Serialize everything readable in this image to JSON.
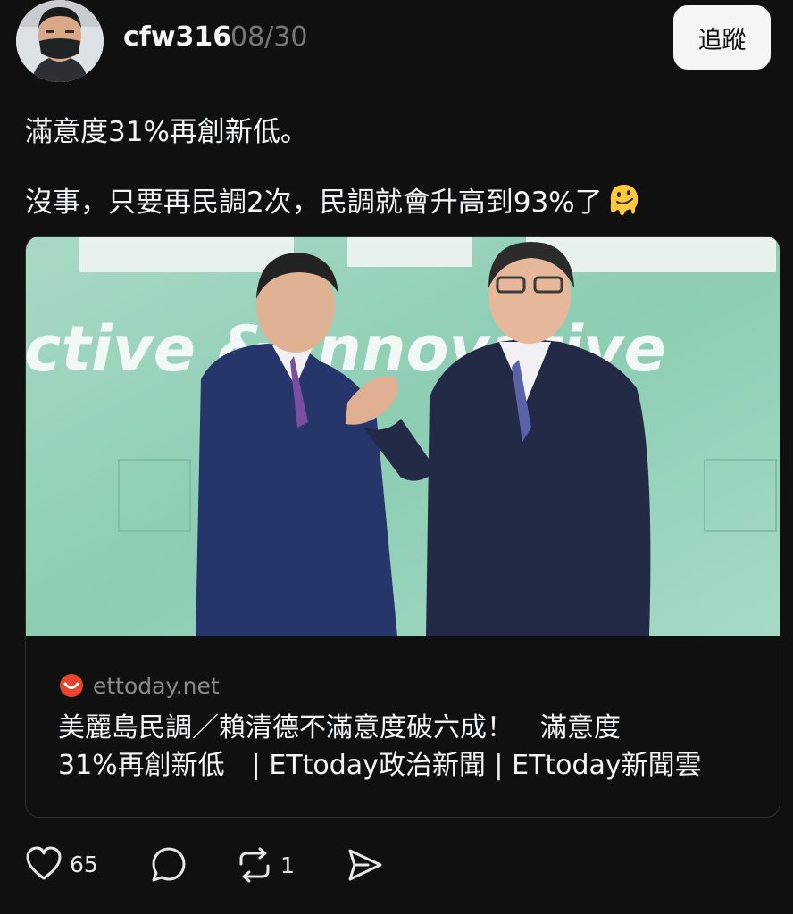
{
  "author": {
    "username": "cfw316",
    "date": "08/30",
    "follow_label": "追蹤"
  },
  "post": {
    "line1": "滿意度31%再創新低。",
    "line2": "沒事，只要再民調2次，民調就會升高到93%了"
  },
  "link_card": {
    "source": "ettoday.net",
    "title_line1": "美麗島民調／賴清德不滿意度破六成！　滿意度",
    "title_line2": "31%再創新低　| ETtoday政治新聞 | ETtoday新聞雲",
    "photo_backdrop_text": "ctive & Innovative"
  },
  "actions": {
    "likes": "65",
    "reposts": "1"
  },
  "icons": [
    "heart-icon",
    "comment-icon",
    "repost-icon",
    "share-icon",
    "melting-face-emoji",
    "ettoday-logo-icon"
  ],
  "colors": {
    "background": "#101010",
    "text": "#f3f5f7",
    "muted": "#777777",
    "button": "#f5f5f5",
    "ettoday_red": "#e8452c"
  }
}
